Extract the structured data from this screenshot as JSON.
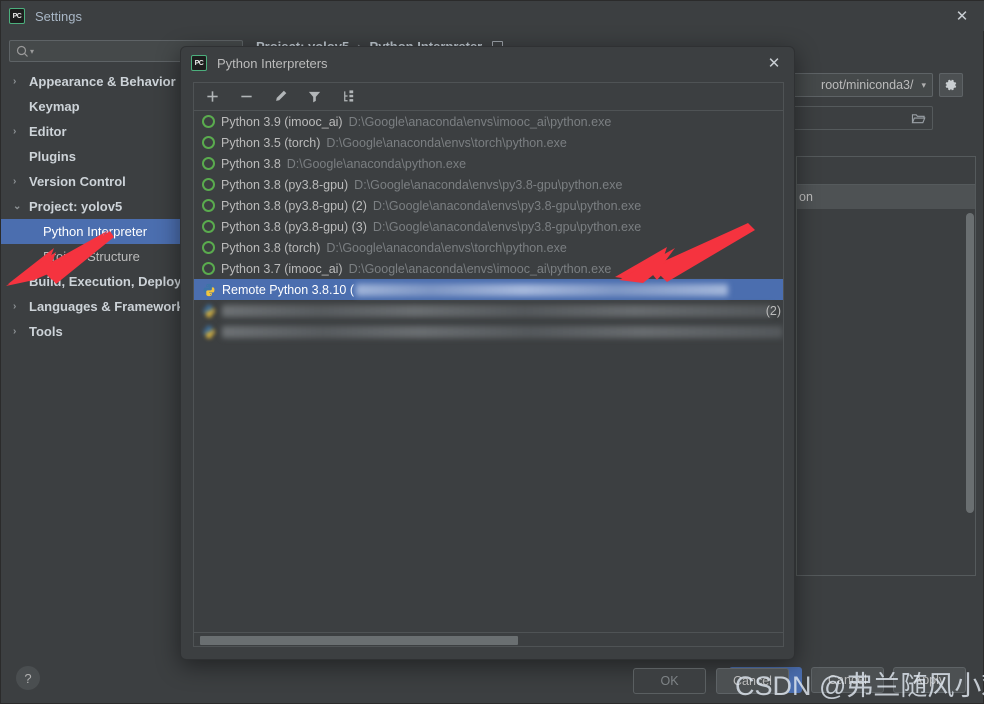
{
  "settings": {
    "title": "Settings",
    "close_icon": "close-icon",
    "search": {
      "placeholder": "",
      "icon": "search-icon"
    },
    "breadcrumb": {
      "project": "Project: yolov5",
      "separator": "›",
      "page": "Python Interpreter"
    },
    "interpreter_combo": {
      "value": "root/miniconda3/",
      "caret": "▾"
    },
    "gear_icon": "gear-icon",
    "folder_icon": "folder-icon",
    "package_row": "on",
    "help_label": "?",
    "buttons": {
      "ok": "OK",
      "cancel": "Cancel",
      "apply": "Apply"
    },
    "tree": [
      {
        "label": "Appearance & Behavior",
        "chev": "›",
        "bold": true,
        "indent": false,
        "selected": false
      },
      {
        "label": "Keymap",
        "chev": "",
        "bold": true,
        "indent": false,
        "selected": false
      },
      {
        "label": "Editor",
        "chev": "›",
        "bold": true,
        "indent": false,
        "selected": false
      },
      {
        "label": "Plugins",
        "chev": "",
        "bold": true,
        "indent": false,
        "selected": false
      },
      {
        "label": "Version Control",
        "chev": "›",
        "bold": true,
        "indent": false,
        "selected": false
      },
      {
        "label": "Project: yolov5",
        "chev": "⌄",
        "bold": true,
        "indent": false,
        "selected": false
      },
      {
        "label": "Python Interpreter",
        "chev": "",
        "bold": false,
        "indent": true,
        "selected": true
      },
      {
        "label": "Project Structure",
        "chev": "",
        "bold": false,
        "indent": true,
        "selected": false
      },
      {
        "label": "Build, Execution, Deploy",
        "chev": "›",
        "bold": true,
        "indent": false,
        "selected": false
      },
      {
        "label": "Languages & Framework",
        "chev": "›",
        "bold": true,
        "indent": false,
        "selected": false
      },
      {
        "label": "Tools",
        "chev": "›",
        "bold": true,
        "indent": false,
        "selected": false
      }
    ]
  },
  "dialog": {
    "title": "Python Interpreters",
    "close_icon": "close-icon",
    "toolbar": [
      {
        "icon": "plus-icon",
        "name": "add-interpreter-button"
      },
      {
        "icon": "minus-icon",
        "name": "remove-interpreter-button"
      },
      {
        "icon": "pencil-icon",
        "name": "edit-interpreter-button"
      },
      {
        "icon": "filter-icon",
        "name": "filter-button"
      },
      {
        "icon": "show-all-icon",
        "name": "show-paths-button"
      }
    ],
    "buttons": {
      "ok": "OK",
      "cancel": "Cancel"
    },
    "interpreters": [
      {
        "name": "Python 3.9 (imooc_ai)",
        "path": "D:\\Google\\anaconda\\envs\\imooc_ai\\python.exe",
        "icon": "env-circle-icon",
        "selected": false,
        "blurred": false
      },
      {
        "name": "Python 3.5 (torch)",
        "path": "D:\\Google\\anaconda\\envs\\torch\\python.exe",
        "icon": "env-circle-icon",
        "selected": false,
        "blurred": false
      },
      {
        "name": "Python 3.8",
        "path": "D:\\Google\\anaconda\\python.exe",
        "icon": "env-circle-icon",
        "selected": false,
        "blurred": false
      },
      {
        "name": "Python 3.8 (py3.8-gpu)",
        "path": "D:\\Google\\anaconda\\envs\\py3.8-gpu\\python.exe",
        "icon": "env-circle-icon",
        "selected": false,
        "blurred": false
      },
      {
        "name": "Python 3.8 (py3.8-gpu) (2)",
        "path": "D:\\Google\\anaconda\\envs\\py3.8-gpu\\python.exe",
        "icon": "env-circle-icon",
        "selected": false,
        "blurred": false
      },
      {
        "name": "Python 3.8 (py3.8-gpu) (3)",
        "path": "D:\\Google\\anaconda\\envs\\py3.8-gpu\\python.exe",
        "icon": "env-circle-icon",
        "selected": false,
        "blurred": false
      },
      {
        "name": "Python 3.8 (torch)",
        "path": "D:\\Google\\anaconda\\envs\\torch\\python.exe",
        "icon": "env-circle-icon",
        "selected": false,
        "blurred": false
      },
      {
        "name": "Python 3.7 (imooc_ai)",
        "path": "D:\\Google\\anaconda\\envs\\imooc_ai\\python.exe",
        "icon": "env-circle-icon",
        "selected": false,
        "blurred": false
      },
      {
        "name": "Remote Python 3.8.10 (",
        "path": "",
        "icon": "python-logo-icon",
        "selected": true,
        "blurred": true
      },
      {
        "name": "",
        "path": "",
        "suffix": "(2)",
        "icon": "python-logo-icon",
        "selected": false,
        "blurred": true
      },
      {
        "name": "",
        "path": "",
        "icon": "python-logo-icon",
        "selected": false,
        "blurred": true
      }
    ]
  },
  "watermark": {
    "text": "CSDN @弗兰随风小欢"
  },
  "colors": {
    "selection_blue": "#4b6eaf",
    "window_bg": "#3c3f41",
    "text": "#bbbbbb",
    "muted_text": "#7b7f82",
    "env_green": "#5aab4e",
    "arrow_red": "#f5333f"
  }
}
